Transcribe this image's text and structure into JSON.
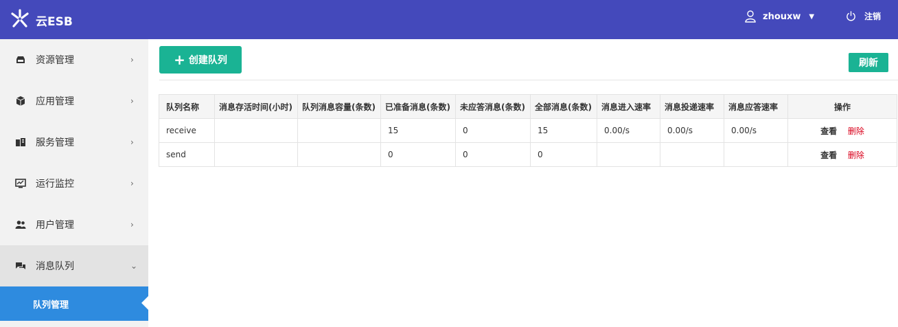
{
  "header": {
    "brand": "云ESB",
    "username": "zhouxw",
    "logout_label": "注销",
    "bg_color": "#4449bb"
  },
  "sidebar": {
    "items": [
      {
        "label": "资源管理",
        "icon": "drive-icon"
      },
      {
        "label": "应用管理",
        "icon": "cube-icon"
      },
      {
        "label": "服务管理",
        "icon": "server-icon"
      },
      {
        "label": "运行监控",
        "icon": "monitor-icon"
      },
      {
        "label": "用户管理",
        "icon": "users-icon"
      },
      {
        "label": "消息队列",
        "icon": "chat-icon",
        "expanded": true
      }
    ],
    "sub_items": [
      {
        "label": "队列管理",
        "active": true
      }
    ]
  },
  "toolbar": {
    "create_label": "创建队列",
    "refresh_label": "刷新",
    "accent_color": "#1ab394"
  },
  "table": {
    "headers": [
      "队列名称",
      "消息存活时间(小时)",
      "队列消息容量(条数)",
      "已准备消息(条数)",
      "未应答消息(条数)",
      "全部消息(条数)",
      "消息进入速率",
      "消息投递速率",
      "消息应答速率",
      "操作"
    ],
    "rows": [
      {
        "cells": [
          "receive",
          "",
          "",
          "15",
          "0",
          "15",
          "0.00/s",
          "0.00/s",
          "0.00/s"
        ],
        "view": "查看",
        "delete": "删除"
      },
      {
        "cells": [
          "send",
          "",
          "",
          "0",
          "0",
          "0",
          "",
          "",
          ""
        ],
        "view": "查看",
        "delete": "删除"
      }
    ]
  }
}
